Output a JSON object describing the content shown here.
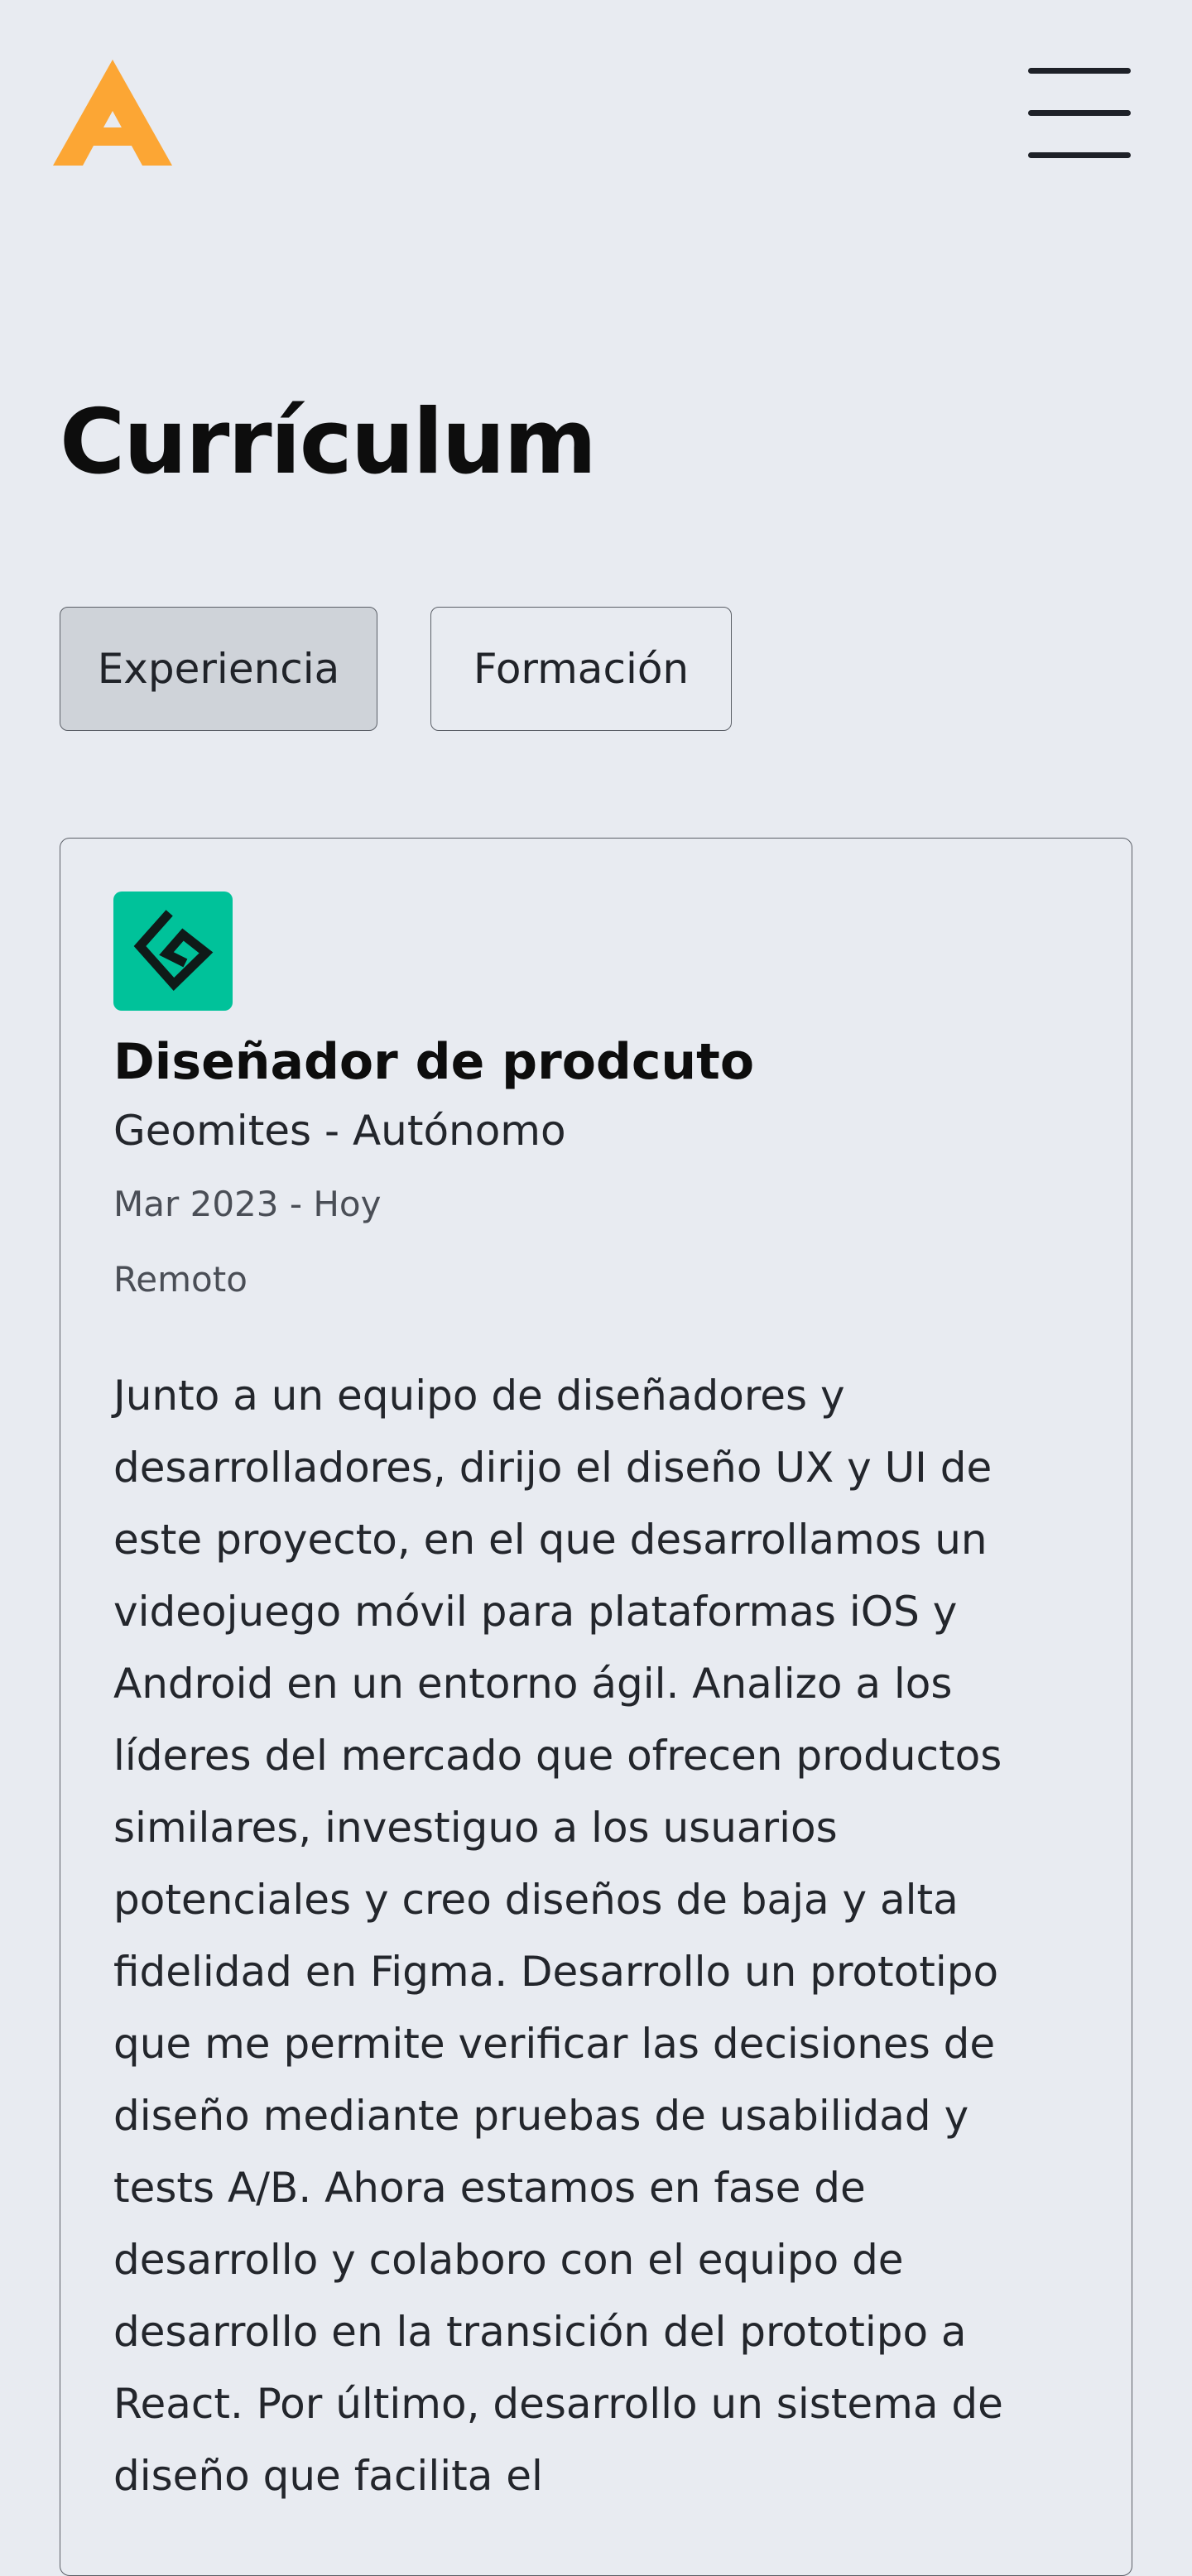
{
  "header": {
    "logo": "brand-a-logo",
    "menu_icon": "hamburger-menu-icon"
  },
  "page": {
    "title": "Currículum"
  },
  "tabs": [
    {
      "label": "Experiencia",
      "active": true
    },
    {
      "label": "Formación",
      "active": false
    }
  ],
  "experience": {
    "logo_icon": "geomites-logo-icon",
    "title": "Diseñador de prodcuto",
    "company": "Geomites - Autónomo",
    "dates": "Mar 2023 - Hoy",
    "location": "Remoto",
    "description": "Junto a un equipo de diseñadores y desarrolladores, dirijo el diseño UX y UI de este proyecto, en el que desarrollamos un videojuego móvil para plataformas iOS y Android en un entorno ágil. Analizo a los líderes del mercado que ofrecen productos similares, investiguo a los usuarios potenciales y creo diseños de baja y alta fidelidad en Figma. Desarrollo un prototipo que me permite verificar las decisiones de diseño mediante pruebas de usabilidad y tests A/B. Ahora estamos en fase de desarrollo y colaboro con el equipo de desarrollo en la transición del prototipo a React. Por último, desarrollo un sistema de diseño que facilita el"
  },
  "colors": {
    "background": "#e8ebf1",
    "brand_orange": "#fca634",
    "active_tab": "#cfd3d9",
    "company_logo_bg": "#00c29a"
  }
}
